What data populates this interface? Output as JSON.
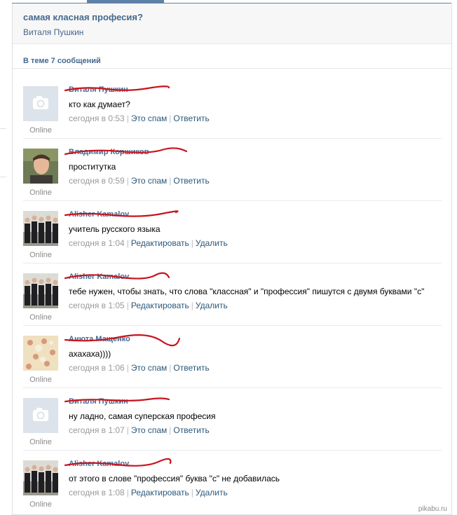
{
  "thread": {
    "title": "самая класная професия?",
    "author": "Виталя Пушкин"
  },
  "count_label": "В теме 7 сообщений",
  "online_label": "Online",
  "posts": [
    {
      "author": "Виталя Пушкин",
      "text": "кто как думает?",
      "time": "сегодня в 0:53",
      "action1": "Это спам",
      "action2": "Ответить",
      "avatar": "placeholder"
    },
    {
      "author": "Владимир Коршиков",
      "text": "проститутка",
      "time": "сегодня в 0:59",
      "action1": "Это спам",
      "action2": "Ответить",
      "avatar": "face"
    },
    {
      "author": "Alisher Kamalov",
      "text": "учитель русского языка",
      "time": "сегодня в 1:04",
      "action1": "Редактировать",
      "action2": "Удалить",
      "avatar": "group"
    },
    {
      "author": "Alisher Kamalov",
      "text": "тебе нужен, чтобы знать, что слова \"классная\" и \"профессия\" пишутся с двумя буквами \"с\"",
      "time": "сегодня в 1:05",
      "action1": "Редактировать",
      "action2": "Удалить",
      "avatar": "group"
    },
    {
      "author": "Анюта Мащенко",
      "text": "ахахаха))))",
      "time": "сегодня в 1:06",
      "action1": "Это спам",
      "action2": "Ответить",
      "avatar": "floral"
    },
    {
      "author": "Виталя Пушкин",
      "text": "ну ладно, самая суперская професия",
      "time": "сегодня в 1:07",
      "action1": "Это спам",
      "action2": "Ответить",
      "avatar": "placeholder"
    },
    {
      "author": "Alisher Kamalov",
      "text": "от этого в слове \"профессия\" буква \"с\" не добавилась",
      "time": "сегодня в 1:08",
      "action1": "Редактировать",
      "action2": "Удалить",
      "avatar": "group"
    }
  ],
  "watermark": "pikabu.ru",
  "colors": {
    "link": "#45688e",
    "action_link": "#2b587a",
    "scribble": "#c8141e",
    "active_tab": "#5e81a8"
  }
}
